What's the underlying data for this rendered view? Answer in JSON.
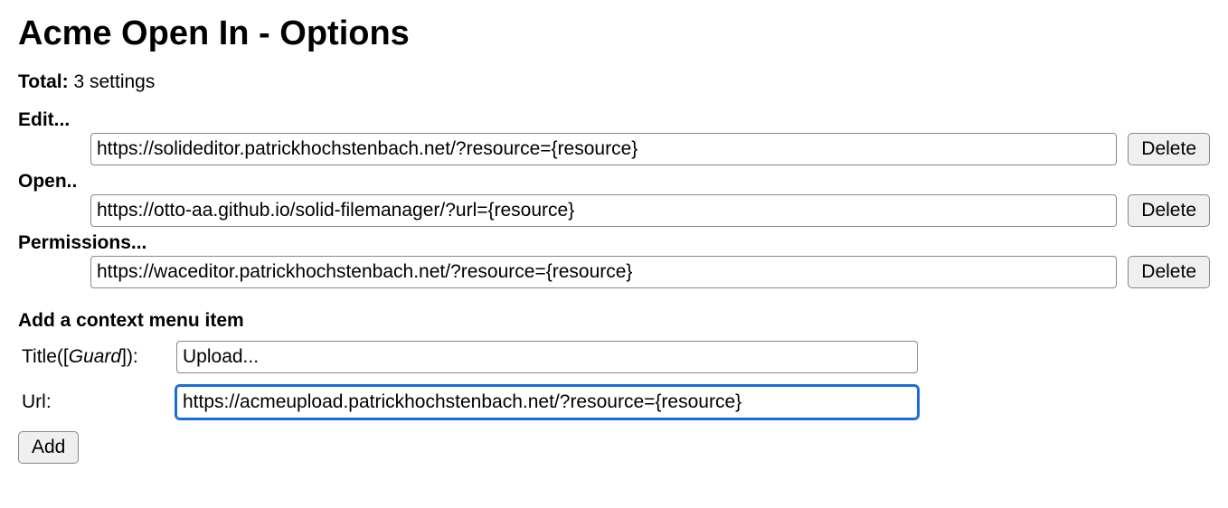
{
  "page": {
    "title": "Acme Open In - Options"
  },
  "total": {
    "label": "Total:",
    "value": "3 settings"
  },
  "settings": [
    {
      "label": "Edit...",
      "url": "https://solideditor.patrickhochstenbach.net/?resource={resource}",
      "delete_label": "Delete"
    },
    {
      "label": "Open..",
      "url": "https://otto-aa.github.io/solid-filemanager/?url={resource}",
      "delete_label": "Delete"
    },
    {
      "label": "Permissions...",
      "url": "https://waceditor.patrickhochstenbach.net/?resource={resource}",
      "delete_label": "Delete"
    }
  ],
  "add_form": {
    "heading": "Add a context menu item",
    "title_label_prefix": "Title([",
    "title_label_guard": "Guard",
    "title_label_suffix": "]):",
    "title_value": "Upload...",
    "url_label": "Url:",
    "url_value": "https://acmeupload.patrickhochstenbach.net/?resource={resource}",
    "add_button_label": "Add"
  }
}
